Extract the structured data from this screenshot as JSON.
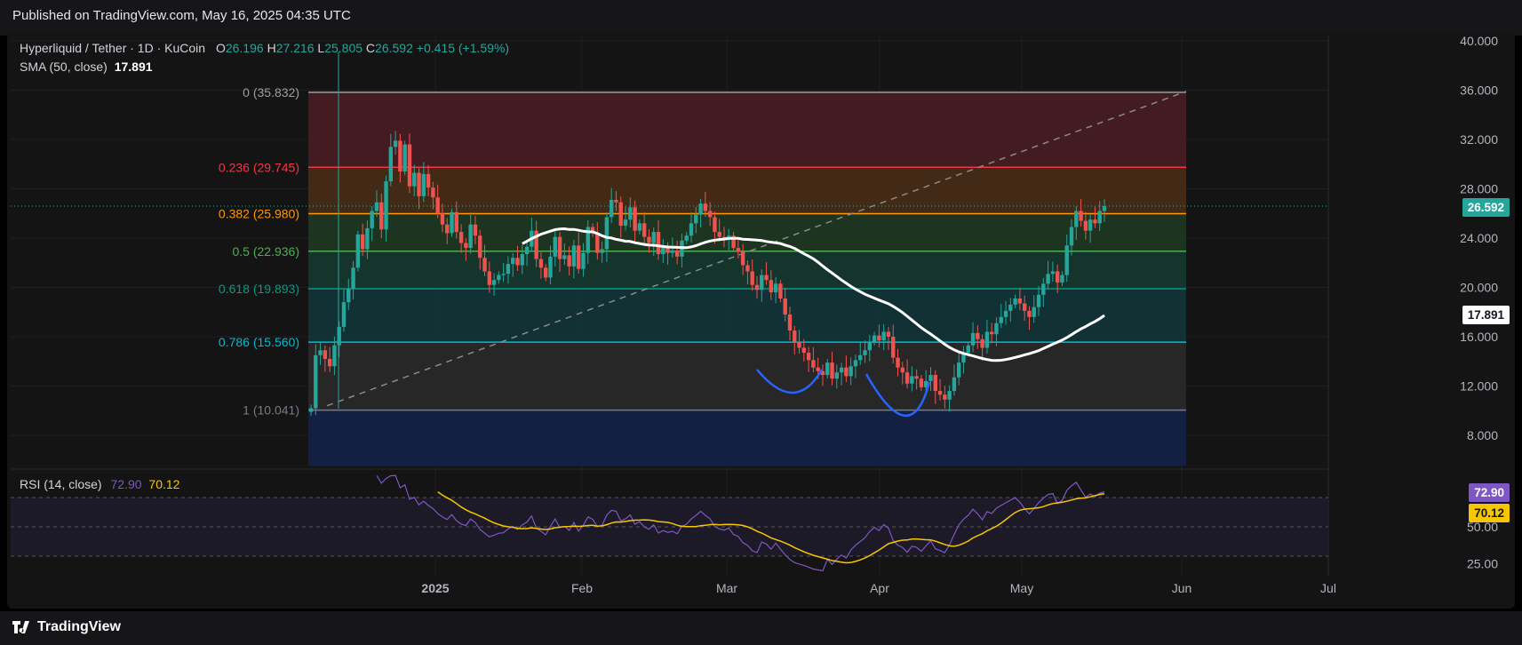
{
  "header": {
    "published": "Published on TradingView.com, May 16, 2025 04:35 UTC"
  },
  "footer": {
    "brand": "TradingView"
  },
  "legend": {
    "symbol": "Hyperliquid / Tether · 1D · KuCoin",
    "o_label": "O",
    "o_value": "26.196",
    "h_label": "H",
    "h_value": "27.216",
    "l_label": "L",
    "l_value": "25.805",
    "c_label": "C",
    "c_value": "26.592",
    "change": "+0.415 (+1.59%)",
    "sma_label": "SMA (50, close)",
    "sma_value": "17.891"
  },
  "rsi_legend": {
    "label": "RSI (14, close)",
    "rsi_value": "72.90",
    "ma_value": "70.12"
  },
  "price_tags": {
    "last": "26.592",
    "sma": "17.891",
    "rsi": "72.90",
    "rsi_ma": "70.12"
  },
  "colors": {
    "up": "#26a69a",
    "down": "#ef5350",
    "sma": "#ffffff",
    "rsi": "#7e57c2",
    "rsi_ma": "#f7c600",
    "pattern": "#2962ff"
  },
  "chart_data": {
    "type": "candlestick",
    "price_axis": {
      "ticks": [
        "40.000",
        "36.000",
        "32.000",
        "28.000",
        "24.000",
        "20.000",
        "16.000",
        "12.000",
        "8.000"
      ],
      "ylim": [
        3.5,
        41.5
      ]
    },
    "time_axis": {
      "labels": [
        "2025",
        "Feb",
        "Mar",
        "Apr",
        "May",
        "Jun",
        "Jul"
      ]
    },
    "fib_levels": [
      {
        "label": "0 (35.832)",
        "value": 35.832,
        "color": "#9e9e9e"
      },
      {
        "label": "0.236 (29.745)",
        "value": 29.745,
        "color": "#f23645"
      },
      {
        "label": "0.382 (25.980)",
        "value": 25.98,
        "color": "#ff9800"
      },
      {
        "label": "0.5 (22.936)",
        "value": 22.936,
        "color": "#4caf50"
      },
      {
        "label": "0.618 (19.893)",
        "value": 19.893,
        "color": "#089981"
      },
      {
        "label": "0.786 (15.560)",
        "value": 15.56,
        "color": "#00bcd4"
      },
      {
        "label": "1 (10.041)",
        "value": 10.041,
        "color": "#787b86"
      }
    ],
    "fib_zone_bottom": 5.5,
    "close_series": [
      10.2,
      14.5,
      14.9,
      14.2,
      13.6,
      15.3,
      16.8,
      18.8,
      19.9,
      21.6,
      24.3,
      23.1,
      24.8,
      26.2,
      26.9,
      24.7,
      28.6,
      31.4,
      31.9,
      29.4,
      31.6,
      28.2,
      29.3,
      27.4,
      29.2,
      28.1,
      27.3,
      26.0,
      25.1,
      24.4,
      26.1,
      24.5,
      23.6,
      23.2,
      25.1,
      24.2,
      22.4,
      21.3,
      20.2,
      20.6,
      21.0,
      21.1,
      21.9,
      22.4,
      21.8,
      22.7,
      23.3,
      24.6,
      22.3,
      21.6,
      20.8,
      22.5,
      24.1,
      22.3,
      22.6,
      21.7,
      23.4,
      21.5,
      22.8,
      24.9,
      24.4,
      22.8,
      23.1,
      25.7,
      27.1,
      26.9,
      25.0,
      25.5,
      26.5,
      24.6,
      25.2,
      24.1,
      23.6,
      24.5,
      22.7,
      23.2,
      22.8,
      23.0,
      22.5,
      23.8,
      24.2,
      25.2,
      25.9,
      26.8,
      26.2,
      25.7,
      24.5,
      24.1,
      23.9,
      24.2,
      23.2,
      22.9,
      21.8,
      21.3,
      20.2,
      19.8,
      21.0,
      20.6,
      19.6,
      20.3,
      19.1,
      17.8,
      16.5,
      15.6,
      15.1,
      14.7,
      14.1,
      13.5,
      13.2,
      12.9,
      13.9,
      12.6,
      13.1,
      13.5,
      12.8,
      13.6,
      14.1,
      14.5,
      14.9,
      15.6,
      16.1,
      15.7,
      16.4,
      16.0,
      14.3,
      13.5,
      13.1,
      12.2,
      12.8,
      12.6,
      11.9,
      12.4,
      12.9,
      11.6,
      11.3,
      10.9,
      11.6,
      12.7,
      13.9,
      14.7,
      15.3,
      16.3,
      15.8,
      15.1,
      16.4,
      16.2,
      17.1,
      17.6,
      18.1,
      18.6,
      19.1,
      18.7,
      18.1,
      17.6,
      18.4,
      19.4,
      20.3,
      21.1,
      21.3,
      20.4,
      21.0,
      23.4,
      24.9,
      26.2,
      25.4,
      24.6,
      25.5,
      25.2,
      26.2,
      26.592
    ],
    "sma50": {
      "label": "SMA (50, close)",
      "last": 17.891
    },
    "rsi": {
      "label": "RSI (14, close)",
      "last": 72.9,
      "ma_last": 70.12,
      "axis_ticks": [
        "50.00",
        "25.00"
      ],
      "bands": [
        70,
        50,
        30
      ]
    }
  }
}
